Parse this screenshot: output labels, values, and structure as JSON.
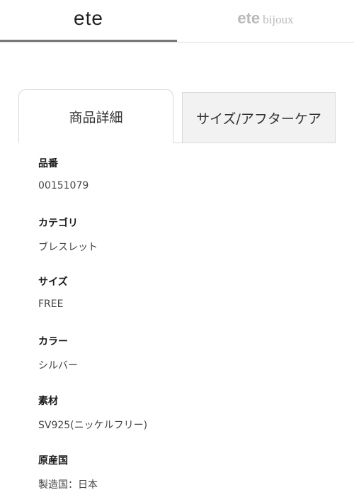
{
  "brand_tabs": {
    "left": {
      "name": "ete"
    },
    "right": {
      "name": "ete",
      "suffix": "bijoux"
    }
  },
  "detail_tabs": [
    {
      "label": "商品詳細",
      "active": true
    },
    {
      "label": "サイズ/アフターケア",
      "active": false
    }
  ],
  "specs": [
    {
      "label": "品番",
      "value": "00151079"
    },
    {
      "label": "カテゴリ",
      "value": "ブレスレット"
    },
    {
      "label": "サイズ",
      "value": "FREE"
    },
    {
      "label": "カラー",
      "value": "シルバー"
    },
    {
      "label": "素材",
      "value": "SV925(ニッケルフリー)"
    },
    {
      "label": "原産国",
      "value": "製造国：日本"
    }
  ],
  "colors": {
    "active_underline": "#777777",
    "inactive_tab_bg": "#f2f2f2",
    "muted_brand": "#b9b9b9"
  }
}
